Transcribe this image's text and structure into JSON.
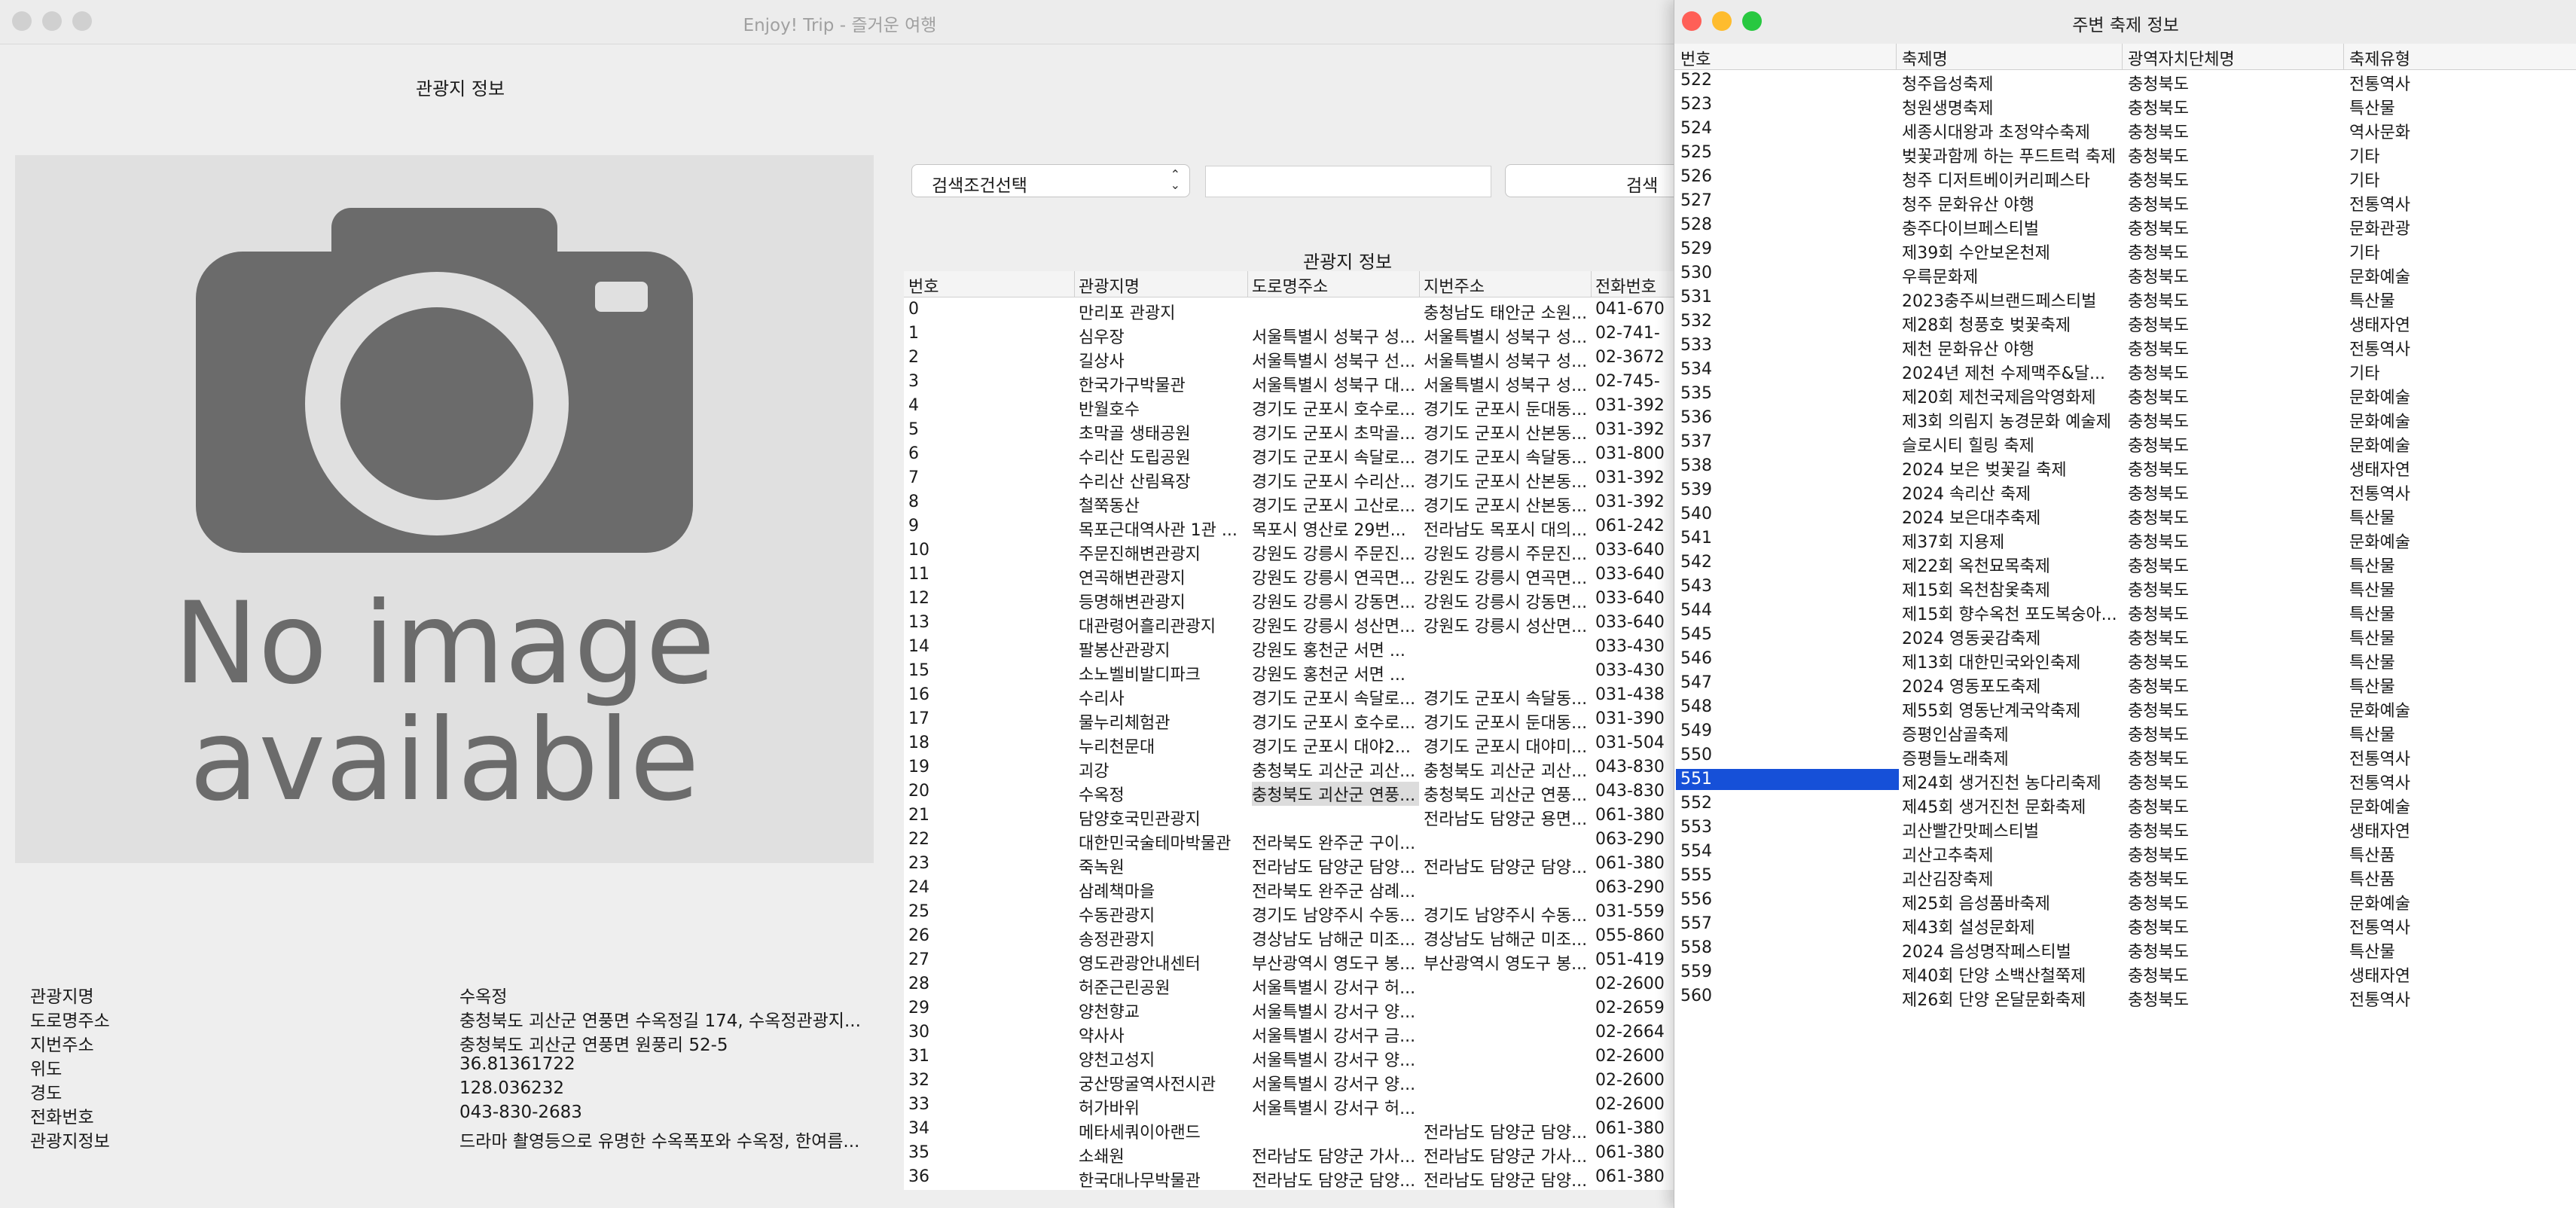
{
  "main_window": {
    "title": "Enjoy! Trip - 즐거운 여행",
    "section_title": "관광지 정보",
    "photo_text_line1": "No image",
    "photo_text_line2": "available",
    "details": [
      {
        "label": "관광지명",
        "value": "수옥정"
      },
      {
        "label": "도로명주소",
        "value": "충청북도 괴산군 연풍면 수옥정길 174, 수옥정관광지..."
      },
      {
        "label": "지번주소",
        "value": "충청북도 괴산군 연풍면 원풍리 52-5"
      },
      {
        "label": "위도",
        "value": "36.81361722"
      },
      {
        "label": "경도",
        "value": "128.036232"
      },
      {
        "label": "전화번호",
        "value": "043-830-2683"
      },
      {
        "label": "관광지정보",
        "value": "드라마 촬영등으로 유명한 수옥폭포와 수옥정, 한여름..."
      }
    ],
    "search": {
      "select_value": "검색조건선택",
      "input_value": "",
      "button_label": "검색"
    },
    "table_title": "관광지 정보",
    "tour_columns": [
      "번호",
      "관광지명",
      "도로명주소",
      "지번주소",
      "전화번호"
    ],
    "tour_rows": [
      [
        "0",
        "만리포 관광지",
        "",
        "충청남도 태안군 소원...",
        "041-670"
      ],
      [
        "1",
        "심우장",
        "서울특별시 성북구 성...",
        "서울특별시 성북구 성...",
        "02-741-"
      ],
      [
        "2",
        "길상사",
        "서울특별시 성북구 선...",
        "서울특별시 성북구 성...",
        "02-3672"
      ],
      [
        "3",
        "한국가구박물관",
        "서울특별시 성북구 대...",
        "서울특별시 성북구 성...",
        "02-745-"
      ],
      [
        "4",
        "반월호수",
        "경기도 군포시 호수로...",
        "경기도 군포시 둔대동...",
        "031-392"
      ],
      [
        "5",
        "초막골 생태공원",
        "경기도 군포시 초막골...",
        "경기도 군포시 산본동...",
        "031-392"
      ],
      [
        "6",
        "수리산 도립공원",
        "경기도 군포시 속달로...",
        "경기도 군포시 속달동...",
        "031-800"
      ],
      [
        "7",
        "수리산 산림욕장",
        "경기도 군포시 수리산...",
        "경기도 군포시 산본동...",
        "031-392"
      ],
      [
        "8",
        "철쭉동산",
        "경기도 군포시 고산로...",
        "경기도 군포시 산본동...",
        "031-392"
      ],
      [
        "9",
        "목포근대역사관 1관 ...",
        "목포시 영산로 29번...",
        "전라남도 목포시 대의...",
        "061-242"
      ],
      [
        "10",
        "주문진해변관광지",
        "강원도 강릉시 주문진...",
        "강원도 강릉시 주문진...",
        "033-640"
      ],
      [
        "11",
        "연곡해변관광지",
        "강원도 강릉시 연곡면...",
        "강원도 강릉시 연곡면...",
        "033-640"
      ],
      [
        "12",
        "등명해변관광지",
        "강원도 강릉시 강동면...",
        "강원도 강릉시 강동면...",
        "033-640"
      ],
      [
        "13",
        "대관령어흘리관광지",
        "강원도 강릉시 성산면...",
        "강원도 강릉시 성산면...",
        "033-640"
      ],
      [
        "14",
        "팔봉산관광지",
        "강원도 홍천군 서면 ...",
        "",
        "033-430"
      ],
      [
        "15",
        "소노벨비발디파크",
        "강원도 홍천군 서면 ...",
        "",
        "033-430"
      ],
      [
        "16",
        "수리사",
        "경기도 군포시 속달로...",
        "경기도 군포시 속달동...",
        "031-438"
      ],
      [
        "17",
        "물누리체험관",
        "경기도 군포시 호수로...",
        "경기도 군포시 둔대동...",
        "031-390"
      ],
      [
        "18",
        "누리천문대",
        "경기도 군포시 대야2...",
        "경기도 군포시 대야미...",
        "031-504"
      ],
      [
        "19",
        "괴강",
        "충청북도 괴산군 괴산...",
        "충청북도 괴산군 괴산...",
        "043-830"
      ],
      [
        "20",
        "수옥정",
        "충청북도 괴산군 연풍...",
        "충청북도 괴산군 연풍...",
        "043-830"
      ],
      [
        "21",
        "담양호국민관광지",
        "",
        "전라남도 담양군 용면...",
        "061-380"
      ],
      [
        "22",
        "대한민국술테마박물관",
        "전라북도 완주군 구이...",
        "",
        "063-290"
      ],
      [
        "23",
        "죽녹원",
        "전라남도 담양군 담양...",
        "전라남도 담양군 담양...",
        "061-380"
      ],
      [
        "24",
        "삼례책마을",
        "전라북도 완주군 삼례...",
        "",
        "063-290"
      ],
      [
        "25",
        "수동관광지",
        "경기도 남양주시 수동...",
        "경기도 남양주시 수동...",
        "031-559"
      ],
      [
        "26",
        "송정관광지",
        "경상남도 남해군 미조...",
        "경상남도 남해군 미조...",
        "055-860"
      ],
      [
        "27",
        "영도관광안내센터",
        "부산광역시 영도구 봉...",
        "부산광역시 영도구 봉...",
        "051-419"
      ],
      [
        "28",
        "허준근린공원",
        "서울특별시 강서구 허...",
        "",
        "02-2600"
      ],
      [
        "29",
        "양천향교",
        "서울특별시 강서구 양...",
        "",
        "02-2659"
      ],
      [
        "30",
        "약사사",
        "서울특별시 강서구 금...",
        "",
        "02-2664"
      ],
      [
        "31",
        "양천고성지",
        "서울특별시 강서구 양...",
        "",
        "02-2600"
      ],
      [
        "32",
        "궁산땅굴역사전시관",
        "서울특별시 강서구 양...",
        "",
        "02-2600"
      ],
      [
        "33",
        "허가바위",
        "서울특별시 강서구 허...",
        "",
        "02-2600"
      ],
      [
        "34",
        "메타세쿼이아랜드",
        "",
        "전라남도 담양군 담양...",
        "061-380"
      ],
      [
        "35",
        "소쇄원",
        "전라남도 담양군 가사...",
        "전라남도 담양군 가사...",
        "061-380"
      ],
      [
        "36",
        "한국대나무박물관",
        "전라남도 담양군 담양...",
        "전라남도 담양군 담양...",
        "061-380"
      ]
    ]
  },
  "festival_window": {
    "title": "주변 축제 정보",
    "columns": [
      "번호",
      "축제명",
      "광역자치단체명",
      "축제유형"
    ],
    "selected_number": "551",
    "rows": [
      [
        "522",
        "청주읍성축제",
        "충청북도",
        "전통역사"
      ],
      [
        "523",
        "청원생명축제",
        "충청북도",
        "특산물"
      ],
      [
        "524",
        "세종시대왕과 초정약수축제",
        "충청북도",
        "역사문화"
      ],
      [
        "525",
        "벚꽃과함께 하는 푸드트럭 축제",
        "충청북도",
        "기타"
      ],
      [
        "526",
        "청주 디저트베이커리페스타",
        "충청북도",
        "기타"
      ],
      [
        "527",
        "청주 문화유산 야행",
        "충청북도",
        "전통역사"
      ],
      [
        "528",
        "충주다이브페스티벌",
        "충청북도",
        "문화관광"
      ],
      [
        "529",
        "제39회 수안보온천제",
        "충청북도",
        "기타"
      ],
      [
        "530",
        "우륵문화제",
        "충청북도",
        " 문화예술"
      ],
      [
        "531",
        "2023충주씨브랜드페스티벌",
        "충청북도",
        "특산물"
      ],
      [
        "532",
        "제28회 청풍호 벚꽃축제",
        "충청북도",
        "생태자연"
      ],
      [
        "533",
        "제천 문화유산 야행",
        "충청북도",
        "전통역사"
      ],
      [
        "534",
        "2024년 제천 수제맥주&달...",
        "충청북도",
        "기타"
      ],
      [
        "535",
        "제20회 제천국제음악영화제",
        "충청북도",
        "문화예술"
      ],
      [
        "536",
        "제3회 의림지 농경문화 예술제",
        "충청북도",
        "문화예술"
      ],
      [
        "537",
        "슬로시티 힐링 축제",
        "충청북도",
        "문화예술"
      ],
      [
        "538",
        "2024 보은 벚꽃길 축제",
        "충청북도",
        "생태자연"
      ],
      [
        "539",
        "2024 속리산 축제",
        "충청북도",
        "전통역사"
      ],
      [
        "540",
        "2024 보은대추축제",
        "충청북도",
        "특산물"
      ],
      [
        "541",
        "제37회 지용제",
        "충청북도",
        "문화예술"
      ],
      [
        "542",
        "제22회 옥천묘목축제",
        "충청북도",
        "특산물"
      ],
      [
        "543",
        "제15회 옥천참옻축제",
        "충청북도",
        "특산물"
      ],
      [
        "544",
        "제15회 향수옥천 포도복숭아...",
        "충청북도",
        "특산물"
      ],
      [
        "545",
        "2024 영동곶감축제",
        "충청북도",
        "특산물"
      ],
      [
        "546",
        "제13회 대한민국와인축제",
        "충청북도",
        "특산물"
      ],
      [
        "547",
        "2024 영동포도축제",
        "충청북도",
        "특산물"
      ],
      [
        "548",
        "제55회 영동난계국악축제",
        "충청북도",
        "문화예술"
      ],
      [
        "549",
        "증평인삼골축제",
        "충청북도",
        "특산물"
      ],
      [
        "550",
        "증평들노래축제",
        "충청북도",
        "전통역사"
      ],
      [
        "551",
        "제24회 생거진천 농다리축제",
        "충청북도",
        "전통역사"
      ],
      [
        "552",
        "제45회 생거진천 문화축제",
        "충청북도",
        "문화예술"
      ],
      [
        "553",
        "괴산빨간맛페스티벌",
        "충청북도",
        "생태자연"
      ],
      [
        "554",
        "괴산고추축제",
        "충청북도",
        "특산품"
      ],
      [
        "555",
        "괴산김장축제",
        "충청북도",
        "특산품"
      ],
      [
        "556",
        "제25회 음성품바축제",
        "충청북도",
        "문화예술"
      ],
      [
        "557",
        "제43회 설성문화제",
        "충청북도",
        "전통역사"
      ],
      [
        "558",
        "2024 음성명작페스티벌",
        "충청북도",
        "특산물"
      ],
      [
        "559",
        "제40회 단양 소백산철쭉제",
        "충청북도",
        "생태자연"
      ],
      [
        "560",
        "제26회 단양 온달문화축제",
        "충청북도",
        "전통역사"
      ]
    ]
  },
  "colors": {
    "selection_blue": "#1650d8",
    "close_red": "#ff5f57",
    "minimize_yellow": "#febc2e",
    "zoom_green": "#28c840",
    "inactive_gray": "#d0d0d0"
  },
  "icons": [
    "camera-icon",
    "chevron-updown-icon"
  ]
}
